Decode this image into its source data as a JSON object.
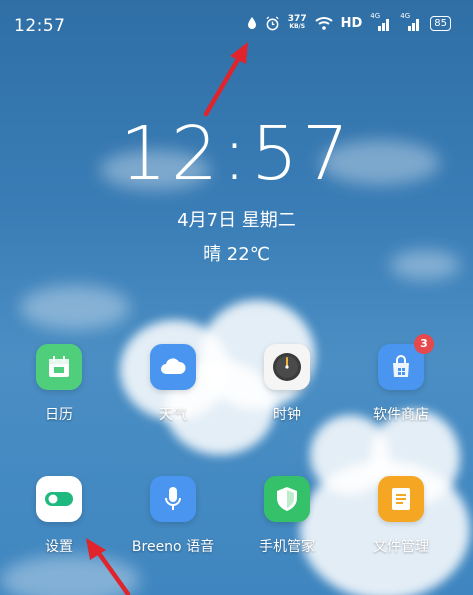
{
  "status_bar": {
    "time": "12:57",
    "net_speed_value": "377",
    "net_speed_unit": "KB/S",
    "hd_label": "HD",
    "sim1_label": "4G",
    "sim2_label": "4G",
    "battery_percent": "85"
  },
  "clock": {
    "time": "12:57",
    "date": "4月7日 星期二",
    "weather": "晴 22℃"
  },
  "apps": [
    {
      "label": "日历",
      "color": "#4fcf7c",
      "icon": "calendar-icon"
    },
    {
      "label": "天气",
      "color": "#4a95f0",
      "icon": "cloud-icon"
    },
    {
      "label": "时钟",
      "color": "#f5f5f5",
      "icon": "clock-icon"
    },
    {
      "label": "软件商店",
      "color": "#4a95f0",
      "icon": "shopping-bag-icon",
      "badge": "3"
    },
    {
      "label": "设置",
      "color": "#ffffff",
      "icon": "toggle-icon"
    },
    {
      "label": "Breeno 语音",
      "color": "#4a95f0",
      "icon": "microphone-icon"
    },
    {
      "label": "手机管家",
      "color": "#34c16a",
      "icon": "shield-icon"
    },
    {
      "label": "文件管理",
      "color": "#f5a623",
      "icon": "document-icon"
    }
  ],
  "colors": {
    "annotation_arrow": "#e0242b",
    "badge": "#e5484d"
  }
}
